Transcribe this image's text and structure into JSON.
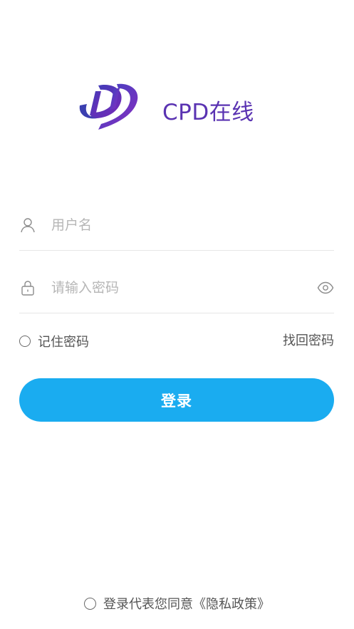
{
  "brand": {
    "name": "CPD在线",
    "color": "#5a33b2",
    "logo_icon": "dd-swoosh-logo"
  },
  "form": {
    "username": {
      "placeholder": "用户名",
      "value": "",
      "icon": "user-icon"
    },
    "password": {
      "placeholder": "请输入密码",
      "value": "",
      "icon": "lock-icon",
      "toggle_icon": "eye-icon"
    },
    "remember_label": "记住密码",
    "remember_checked": false,
    "forgot_label": "找回密码",
    "submit_label": "登录",
    "submit_color": "#1aacf0"
  },
  "agreement": {
    "checked": false,
    "text_prefix": "登录代表您同意",
    "link_text": "《隐私政策》"
  }
}
